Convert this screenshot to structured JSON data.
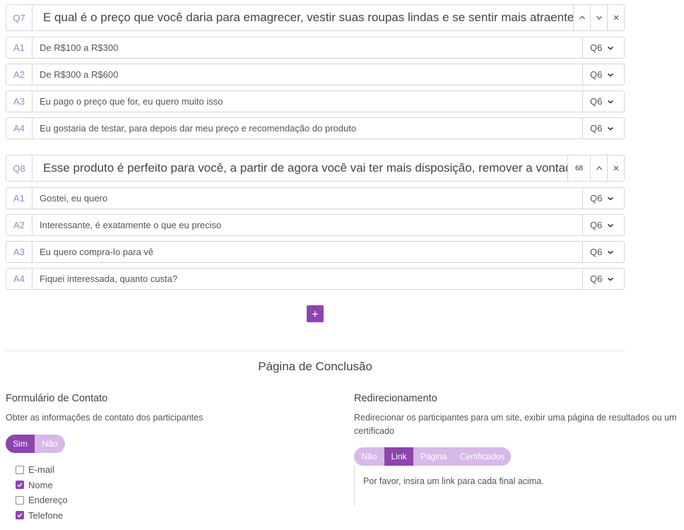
{
  "questions": [
    {
      "num": "Q7",
      "text": "E qual é o preço que você daria para emagrecer, vestir suas roupas lindas e se sentir mais atraente",
      "answers": [
        {
          "num": "A1",
          "text": "De R$100 a R$300",
          "goto": "Q6"
        },
        {
          "num": "A2",
          "text": "De R$300 a R$600",
          "goto": "Q6"
        },
        {
          "num": "A3",
          "text": "Eu pago o preço que for, eu quero muito isso",
          "goto": "Q6"
        },
        {
          "num": "A4",
          "text": "Eu gostaria de testar, para depois dar meu preço e recomendação do produto",
          "goto": "Q6"
        }
      ]
    },
    {
      "num": "Q8",
      "text": "Esse produto é perfeito para você, a partir de agora você vai ter mais disposição, remover a vontade",
      "char_count": "68",
      "answers": [
        {
          "num": "A1",
          "text": "Gostei, eu quero",
          "goto": "Q6"
        },
        {
          "num": "A2",
          "text": "Interessante, é exatamente o que eu preciso",
          "goto": "Q6"
        },
        {
          "num": "A3",
          "text": "Eu quero compra-lo para vê",
          "goto": "Q6"
        },
        {
          "num": "A4",
          "text": "Fiquei interessada, quanto custa?",
          "goto": "Q6"
        }
      ]
    }
  ],
  "add_button": "+",
  "conclusion": {
    "title": "Página de Conclusão",
    "contact": {
      "title": "Formulário de Contato",
      "description": "Obter as informações de contato dos participantes",
      "toggle": [
        "Sim",
        "Não"
      ],
      "toggle_selected": "Sim",
      "fields": [
        {
          "label": "E-mail",
          "checked": false
        },
        {
          "label": "Nome",
          "checked": true
        },
        {
          "label": "Endereço",
          "checked": false
        },
        {
          "label": "Telefone",
          "checked": true
        }
      ]
    },
    "redirect": {
      "title": "Redirecionamento",
      "description_line1": "Redirecionar os participantes para um site, exibir uma página de resultados ou um",
      "description_line2": "certificado",
      "options": [
        "Não",
        "Link",
        "Página",
        "Certificados"
      ],
      "selected": "Link",
      "message": "Por favor, insira um link para cada final acima."
    }
  },
  "colors": {
    "accent": "#8e44ad",
    "accent_light": "#d7b9e8",
    "number": "#9b86c7"
  },
  "icons": [
    "chevron-up-icon",
    "chevron-down-icon",
    "close-icon",
    "plus-icon",
    "check-icon"
  ]
}
